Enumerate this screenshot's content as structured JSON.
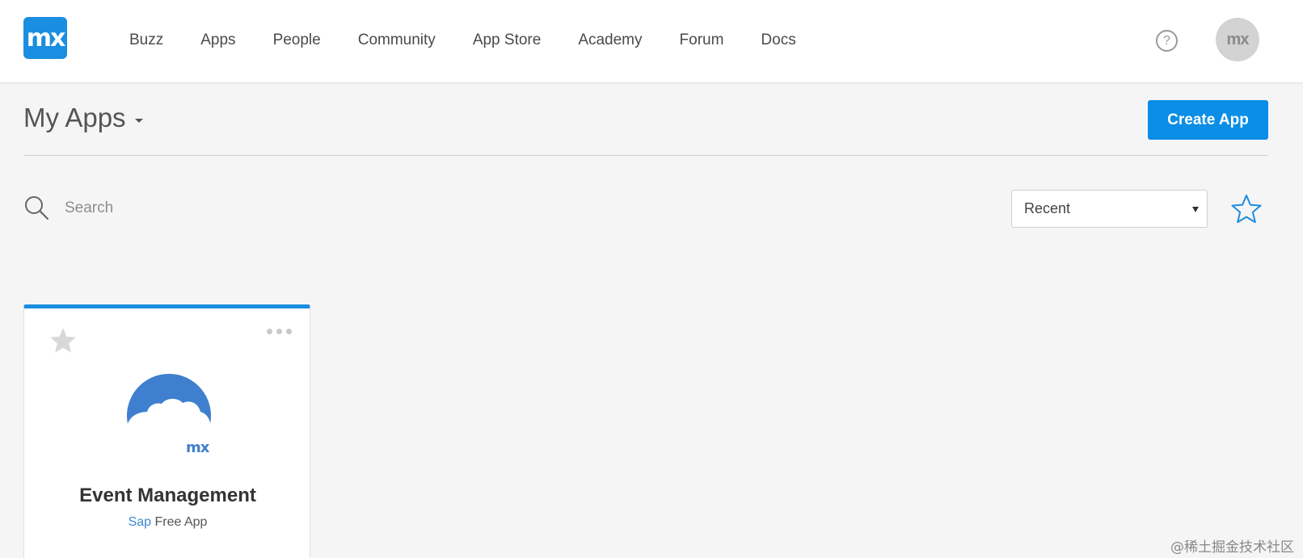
{
  "brand": {
    "logo_text": "mx",
    "avatar_text": "mx"
  },
  "nav": {
    "items": [
      {
        "label": "Buzz"
      },
      {
        "label": "Apps"
      },
      {
        "label": "People"
      },
      {
        "label": "Community"
      },
      {
        "label": "App Store"
      },
      {
        "label": "Academy"
      },
      {
        "label": "Forum"
      },
      {
        "label": "Docs"
      }
    ],
    "help_glyph": "?"
  },
  "header": {
    "title": "My Apps",
    "create_button": "Create App"
  },
  "toolbar": {
    "search_placeholder": "Search",
    "sort_value": "Recent",
    "favorite_filter_icon": "star-outline-icon"
  },
  "apps": [
    {
      "name": "Event Management",
      "owner": "Sap",
      "plan": "Free App",
      "logo_text": "mx"
    }
  ],
  "watermark": "@稀土掘金技术社区",
  "colors": {
    "accent": "#1a8ee0",
    "button": "#0a8ee6",
    "link": "#3a88d0",
    "app_logo": "#3f7fcf"
  }
}
